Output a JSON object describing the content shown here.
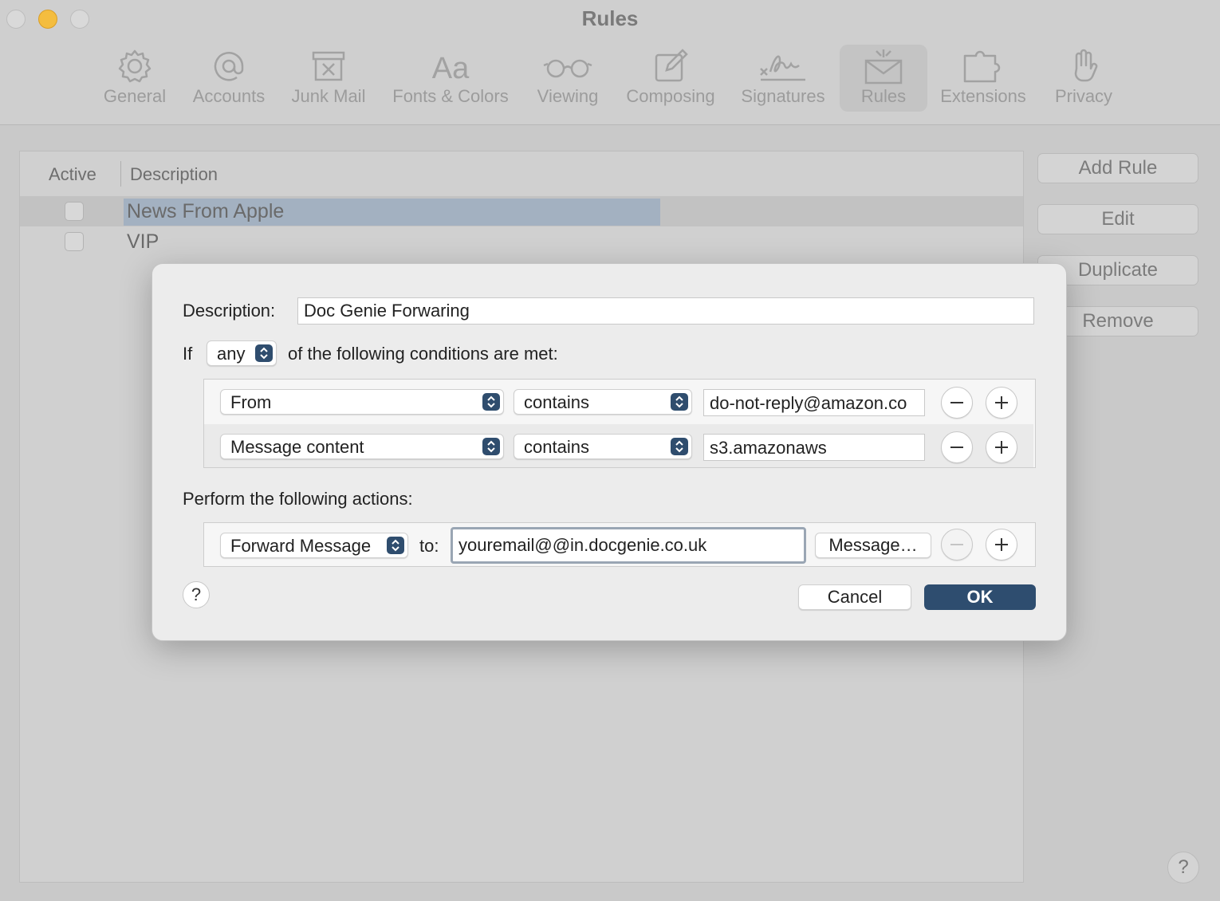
{
  "window": {
    "title": "Rules"
  },
  "toolbar": {
    "items": [
      {
        "label": "General",
        "icon": "gear-icon"
      },
      {
        "label": "Accounts",
        "icon": "at-sign-icon"
      },
      {
        "label": "Junk Mail",
        "icon": "junk-mail-icon"
      },
      {
        "label": "Fonts & Colors",
        "icon": "fonts-icon"
      },
      {
        "label": "Viewing",
        "icon": "glasses-icon"
      },
      {
        "label": "Composing",
        "icon": "compose-icon"
      },
      {
        "label": "Signatures",
        "icon": "signature-icon"
      },
      {
        "label": "Rules",
        "icon": "rules-icon"
      },
      {
        "label": "Extensions",
        "icon": "puzzle-icon"
      },
      {
        "label": "Privacy",
        "icon": "hand-icon"
      }
    ],
    "selected": "Rules"
  },
  "rules_table": {
    "headers": {
      "active": "Active",
      "description": "Description"
    },
    "rows": [
      {
        "description": "News From Apple",
        "active": false,
        "selected": true
      },
      {
        "description": "VIP",
        "active": false,
        "selected": false
      }
    ]
  },
  "side_buttons": {
    "add": "Add Rule",
    "edit": "Edit",
    "duplicate": "Duplicate",
    "remove": "Remove"
  },
  "sheet": {
    "description_label": "Description:",
    "description_value": "Doc Genie Forwaring",
    "if_label": "If",
    "match_popup": "any",
    "conditions_suffix": "of the following conditions are met:",
    "conditions": [
      {
        "field": "From",
        "operator": "contains",
        "value": "do-not-reply@amazon.co"
      },
      {
        "field": "Message content",
        "operator": "contains",
        "value": "s3.amazonaws"
      }
    ],
    "actions_label": "Perform the following actions:",
    "action": {
      "type": "Forward Message",
      "to_label": "to:",
      "to_value": "youremail@@in.docgenie.co.uk",
      "message_button": "Message…"
    },
    "help": "?",
    "cancel": "Cancel",
    "ok": "OK"
  },
  "window_help": "?",
  "colors": {
    "accent": "#2e4d6f",
    "selection": "#a3b1c1",
    "traffic_minimize": "#f4bd3f"
  }
}
